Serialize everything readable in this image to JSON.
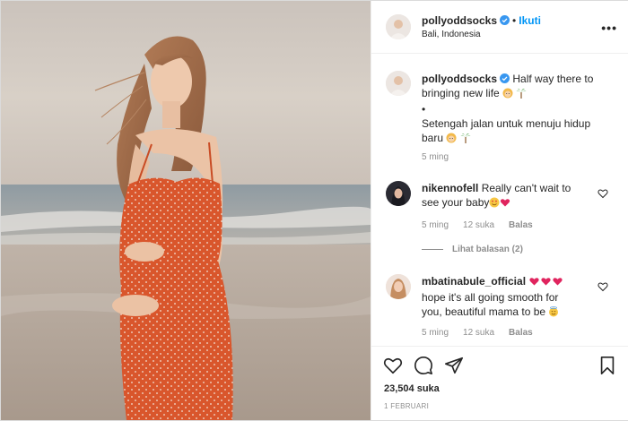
{
  "header": {
    "username": "pollyoddsocks",
    "follow_label": "Ikuti",
    "location": "Bali, Indonesia",
    "more_icon": "more-horizontal-icon"
  },
  "caption": {
    "username": "pollyoddsocks",
    "line1": "Half way there to",
    "line2": "bringing new life",
    "bullet": "•",
    "line3": "Setengah jalan untuk menuju hidup",
    "line4": "baru",
    "time": "5 ming"
  },
  "comments": [
    {
      "username": "nikennofell",
      "text_line1": "Really can't wait to",
      "text_line2": "see your baby",
      "time": "5 ming",
      "likes": "12 suka",
      "reply": "Balas"
    },
    {
      "username": "mbatinabule_official",
      "text_line1": "hope it's all going smooth for",
      "text_line2": "you, beautiful mama to be",
      "time": "5 ming",
      "likes": "12 suka",
      "reply": "Balas"
    }
  ],
  "view_replies": "Lihat balasan (2)",
  "actions": {
    "likes": "23,504 suka",
    "date": "1 FEBRUARI",
    "icons": [
      "heart-icon",
      "comment-icon",
      "share-icon",
      "bookmark-icon"
    ]
  },
  "colors": {
    "accent": "#0095f6",
    "verified": "#3897f0",
    "text": "#262626",
    "muted": "#8e8e8e",
    "dress": "#d9562c"
  }
}
